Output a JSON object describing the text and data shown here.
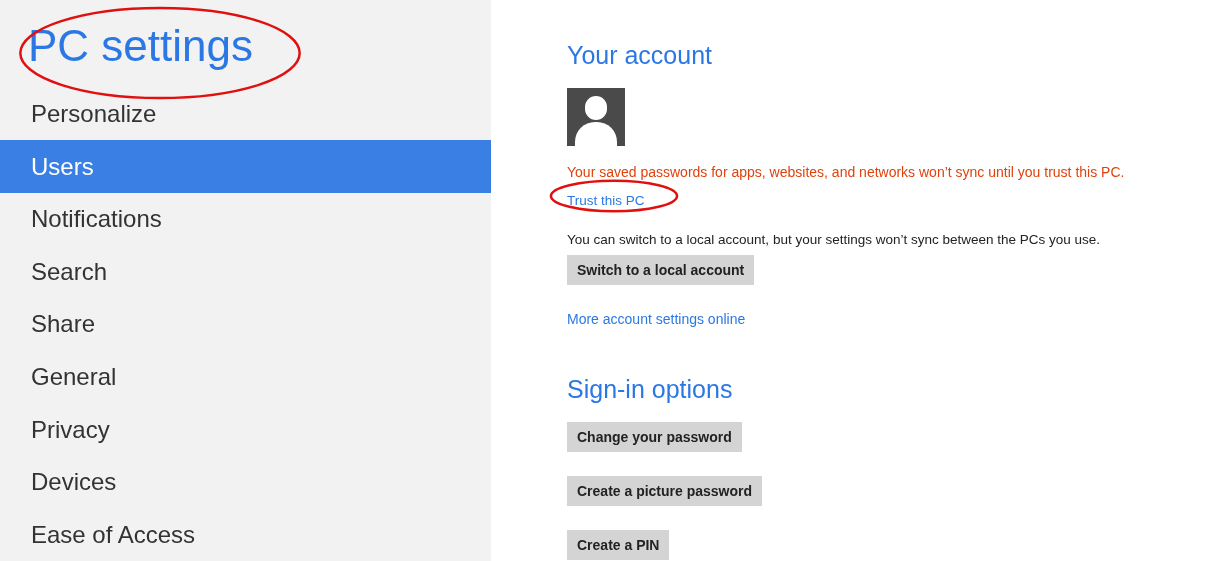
{
  "sidebar": {
    "title": {
      "text": "PC settings",
      "circled": true
    },
    "items": [
      {
        "label": "Personalize",
        "selected": false
      },
      {
        "label": "Users",
        "selected": true
      },
      {
        "label": "Notifications",
        "selected": false
      },
      {
        "label": "Search",
        "selected": false
      },
      {
        "label": "Share",
        "selected": false
      },
      {
        "label": "General",
        "selected": false
      },
      {
        "label": "Privacy",
        "selected": false
      },
      {
        "label": "Devices",
        "selected": false
      },
      {
        "label": "Ease of Access",
        "selected": false
      }
    ]
  },
  "account": {
    "heading": "Your account",
    "warning": "Your saved passwords for apps, websites, and networks won’t sync until you trust this PC.",
    "trust_link": {
      "text": "Trust this PC",
      "circled": true
    },
    "note": "You can switch to a local account, but your settings won’t sync between the PCs you use.",
    "switch_button": "Switch to a local account",
    "more_link": "More account settings online"
  },
  "sign_in": {
    "heading": "Sign-in options",
    "buttons": [
      "Change your password",
      "Create a picture password",
      "Create a PIN"
    ]
  }
}
